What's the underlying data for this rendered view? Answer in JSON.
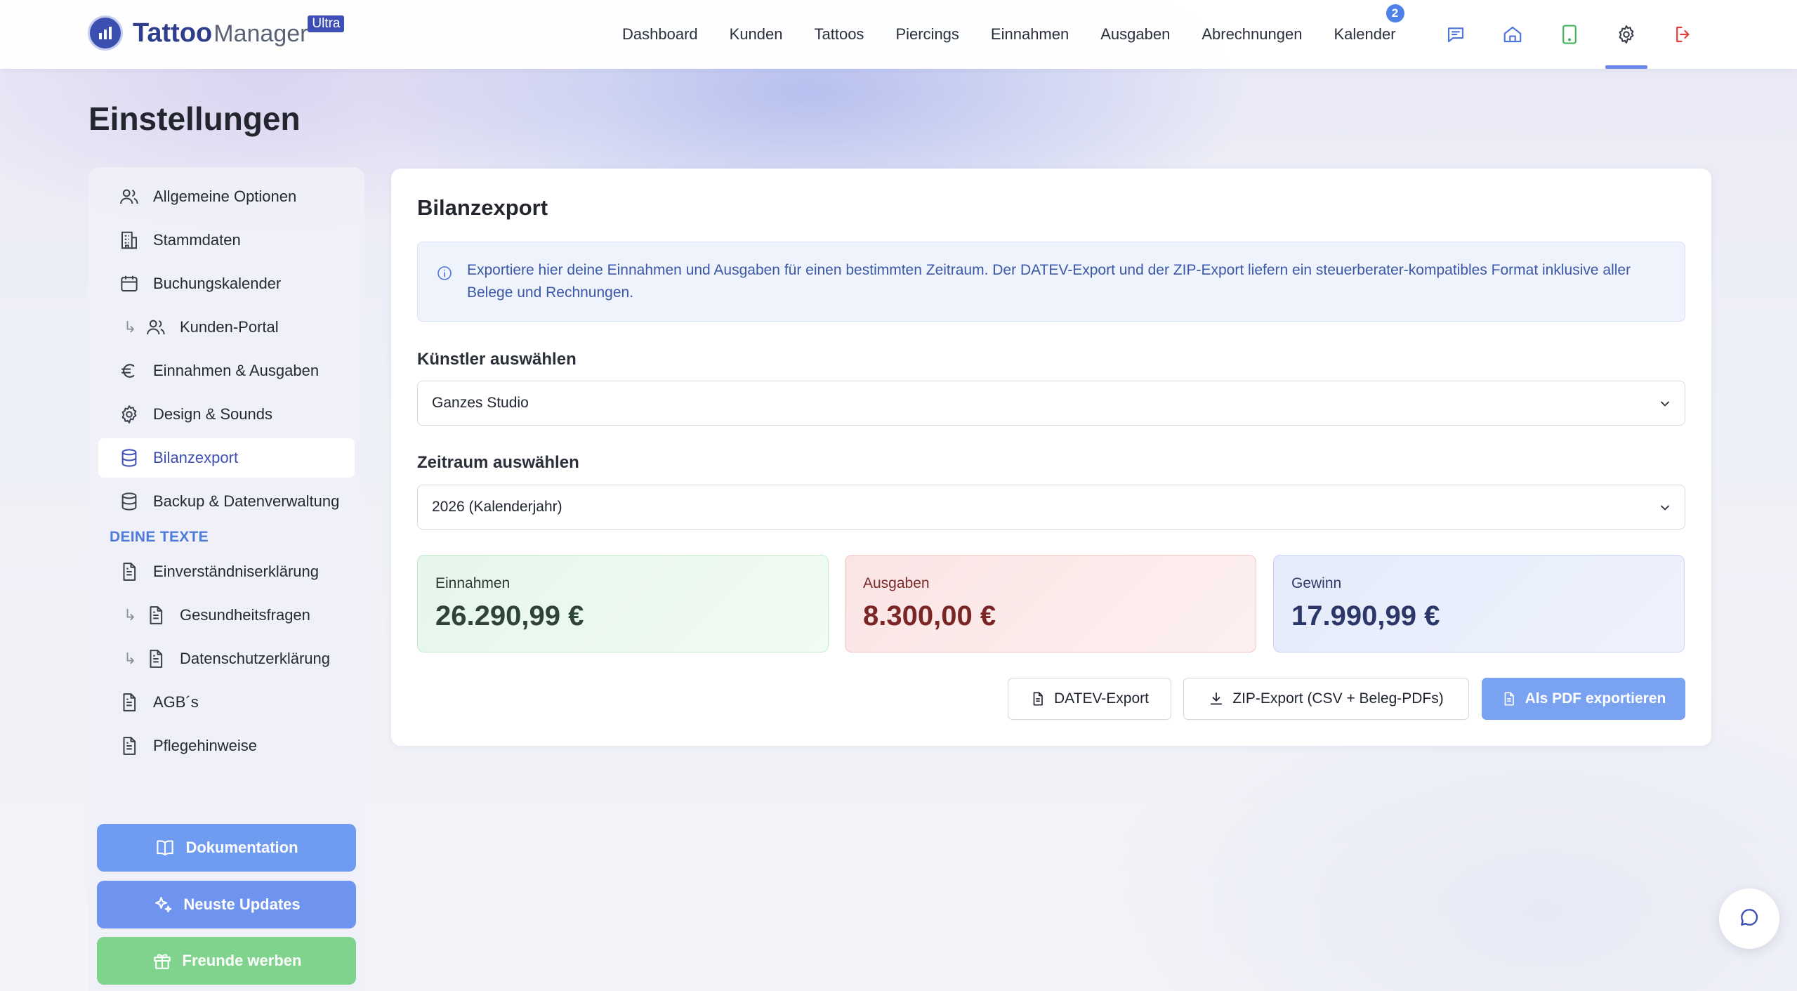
{
  "app": {
    "name_bold": "Tattoo",
    "name_light": "Manager",
    "badge": "Ultra"
  },
  "nav": {
    "items": [
      "Dashboard",
      "Kunden",
      "Tattoos",
      "Piercings",
      "Einnahmen",
      "Ausgaben",
      "Abrechnungen",
      "Kalender"
    ],
    "calendar_badge": "2",
    "icons": [
      "chat-icon",
      "home-icon",
      "tablet-icon",
      "settings-icon",
      "logout-icon"
    ],
    "active_icon": "settings-icon"
  },
  "page": {
    "title": "Einstellungen"
  },
  "sidebar": {
    "items": [
      {
        "label": "Allgemeine Optionen",
        "icon": "users-icon"
      },
      {
        "label": "Stammdaten",
        "icon": "building-icon"
      },
      {
        "label": "Buchungskalender",
        "icon": "calendar-icon"
      },
      {
        "label": "Kunden-Portal",
        "icon": "users-icon"
      },
      {
        "label": "Einnahmen & Ausgaben",
        "icon": "euro-icon"
      },
      {
        "label": "Design & Sounds",
        "icon": "gear-icon"
      },
      {
        "label": "Bilanzexport",
        "icon": "database-icon"
      },
      {
        "label": "Backup & Datenverwaltung",
        "icon": "database-icon"
      }
    ],
    "section_label": "DEINE TEXTE",
    "text_items": [
      {
        "label": "Einverständniserklärung",
        "icon": "document-icon"
      },
      {
        "label": "Gesundheitsfragen",
        "icon": "document-icon"
      },
      {
        "label": "Datenschutzerklärung",
        "icon": "document-icon"
      },
      {
        "label": "AGB´s",
        "icon": "document-icon"
      },
      {
        "label": "Pflegehinweise",
        "icon": "document-icon"
      }
    ],
    "active_item": "Bilanzexport",
    "buttons": {
      "docs": "Dokumentation",
      "updates": "Neuste Updates",
      "referral": "Freunde werben"
    },
    "colors": {
      "docs": "#6f9cf0",
      "updates": "#6f94ef",
      "referral": "#7fd38c"
    }
  },
  "card": {
    "title": "Bilanzexport",
    "info": "Exportiere hier deine Einnahmen und Ausgaben für einen bestimmten Zeitraum. Der DATEV-Export und der ZIP-Export liefern ein steuerberater-kompatibles Format inklusive aller Belege und Rechnungen.",
    "artist_label": "Künstler auswählen",
    "artist_value": "Ganzes Studio",
    "period_label": "Zeitraum auswählen",
    "period_value": "2026 (Kalenderjahr)",
    "stats": {
      "income_label": "Einnahmen",
      "income_value": "26.290,99 €",
      "expenses_label": "Ausgaben",
      "expenses_value": "8.300,00 €",
      "profit_label": "Gewinn",
      "profit_value": "17.990,99 €"
    },
    "buttons": {
      "datev": "DATEV-Export",
      "zip": "ZIP-Export (CSV + Beleg-PDFs)",
      "pdf": "Als PDF exportieren"
    }
  },
  "accent": "#3d4fb4"
}
